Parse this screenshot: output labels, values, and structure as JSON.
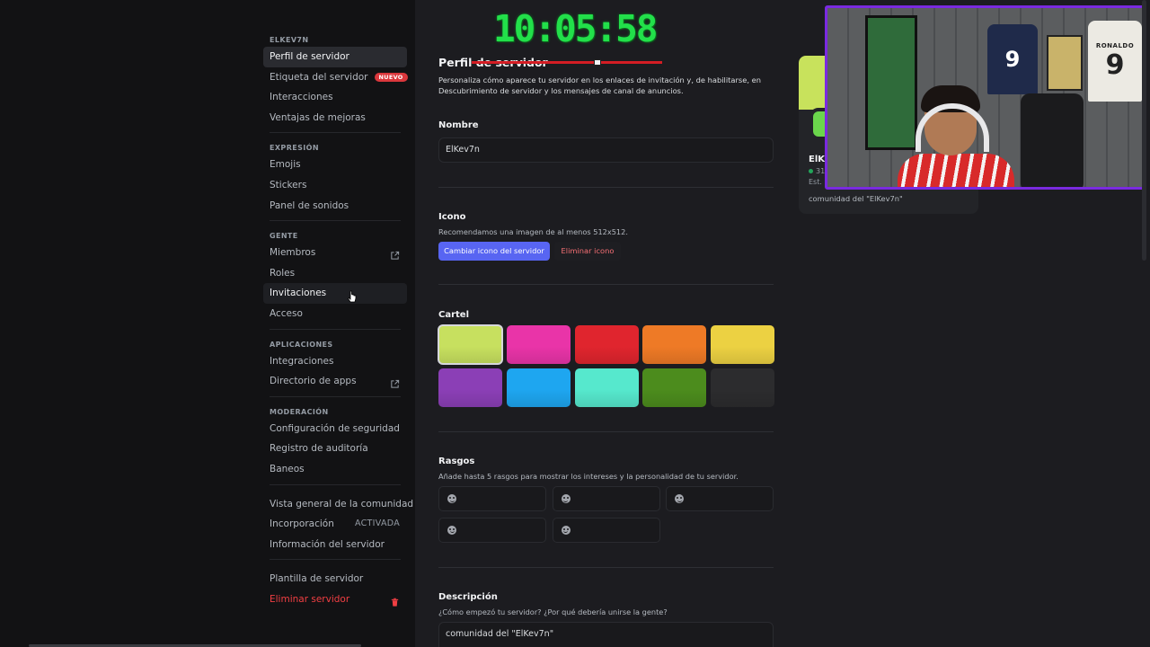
{
  "sidebar": {
    "sections": [
      {
        "header": "ELKEV7N",
        "items": [
          {
            "label": "Perfil de servidor",
            "state": "active"
          },
          {
            "label": "Etiqueta del servidor",
            "badge": "NUEVO"
          },
          {
            "label": "Interacciones"
          },
          {
            "label": "Ventajas de mejoras"
          }
        ]
      },
      {
        "header": "EXPRESIÓN",
        "items": [
          {
            "label": "Emojis"
          },
          {
            "label": "Stickers"
          },
          {
            "label": "Panel de sonidos"
          }
        ]
      },
      {
        "header": "GENTE",
        "items": [
          {
            "label": "Miembros",
            "icon": "external-link-icon"
          },
          {
            "label": "Roles"
          },
          {
            "label": "Invitaciones",
            "state": "hover"
          },
          {
            "label": "Acceso"
          }
        ]
      },
      {
        "header": "APLICACIONES",
        "items": [
          {
            "label": "Integraciones"
          },
          {
            "label": "Directorio de apps",
            "icon": "external-link-icon"
          }
        ]
      },
      {
        "header": "MODERACIÓN",
        "items": [
          {
            "label": "Configuración de seguridad"
          },
          {
            "label": "Registro de auditoría"
          },
          {
            "label": "Baneos"
          }
        ]
      },
      {
        "header": "",
        "items": [
          {
            "label": "Vista general de la comunidad"
          },
          {
            "label": "Incorporación",
            "status": "ACTIVADA"
          },
          {
            "label": "Información del servidor"
          }
        ]
      },
      {
        "header": "",
        "items": [
          {
            "label": "Plantilla de servidor"
          },
          {
            "label": "Eliminar servidor",
            "state": "danger",
            "icon": "trash-icon"
          }
        ]
      }
    ]
  },
  "main": {
    "title": "Perfil de servidor",
    "subtitle": "Personaliza cómo aparece tu servidor en los enlaces de invitación y, de habilitarse, en Descubrimiento de servidor y los mensajes de canal de anuncios.",
    "name_label": "Nombre",
    "name_value": "ElKev7n",
    "icon_label": "Icono",
    "icon_hint": "Recomendamos una imagen de al menos 512x512.",
    "change_icon_button": "Cambiar icono del servidor",
    "remove_icon_button": "Eliminar icono",
    "banner_label": "Cartel",
    "banner_colors": [
      [
        "#c7e05f",
        "#e934a8",
        "#e0252e",
        "#ee7a26",
        "#ecd142"
      ],
      [
        "#8b3fb6",
        "#1ea6f0",
        "#56e8cd",
        "#4c8c1d",
        "#2c2c2e"
      ]
    ],
    "traits_label": "Rasgos",
    "traits_hint": "Añade hasta 5 rasgos para mostrar los intereses y la personalidad de tu servidor.",
    "description_label": "Descripción",
    "description_hint": "¿Cómo empezó tu servidor? ¿Por qué debería unirse la gente?",
    "description_value": "comunidad del \"ElKev7n\""
  },
  "preview": {
    "server_name": "ElKe",
    "members_fragment": "31",
    "est_fragment": "Est.",
    "description": "comunidad del \"ElKev7n\""
  },
  "overlay": {
    "clock": "10:05:58",
    "jersey_left_number": "9",
    "jersey_right_name": "RONALDO",
    "jersey_right_number": "9"
  }
}
